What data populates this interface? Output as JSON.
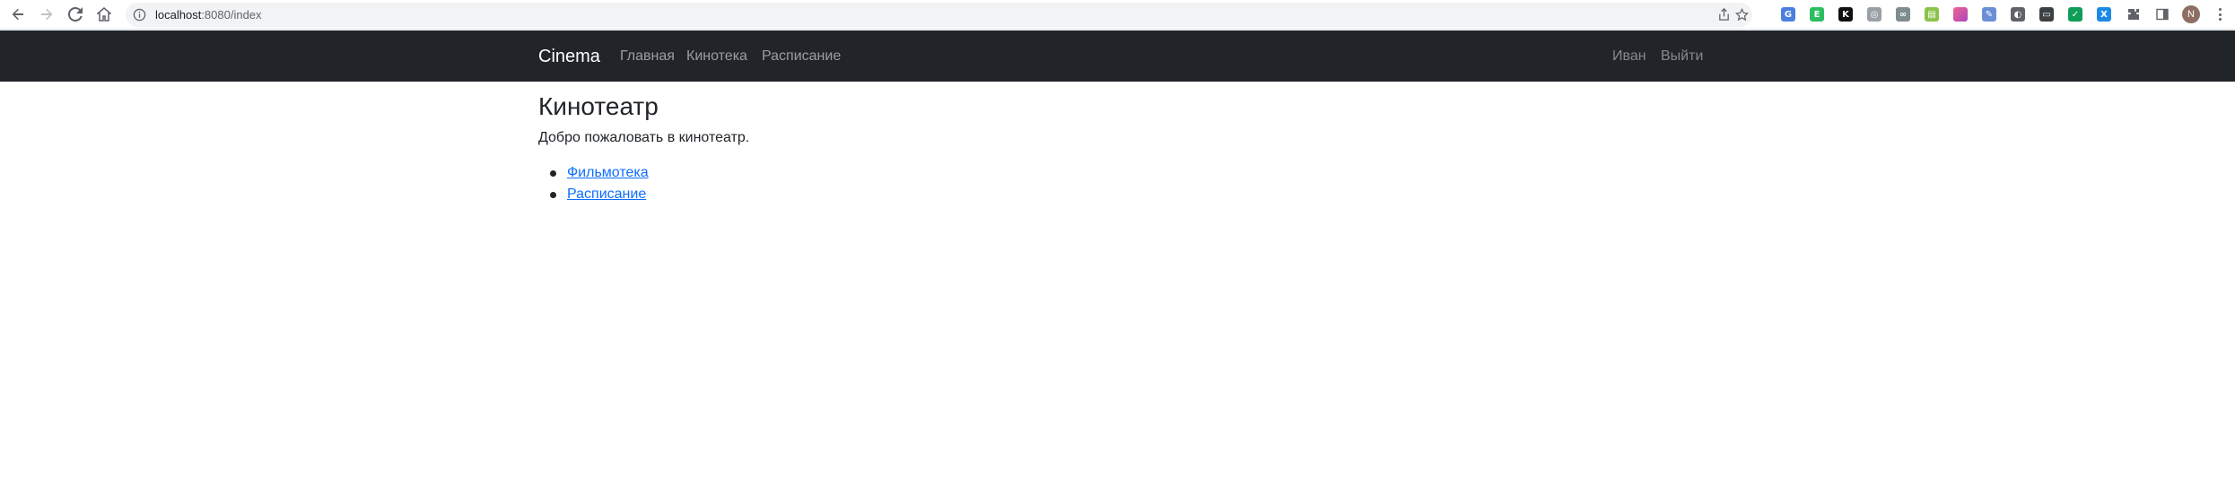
{
  "browser": {
    "url_host": "localhost",
    "url_path": ":8080/index",
    "profile_initial": "N",
    "extensions": [
      {
        "icon": "translate-extension-icon",
        "color": "#4a7fe0",
        "glyph": "G"
      },
      {
        "icon": "evernote-extension-icon",
        "color": "#2dbe60",
        "glyph": "E"
      },
      {
        "icon": "k-extension-icon",
        "color": "#111111",
        "glyph": "K"
      },
      {
        "icon": "circle-extension-icon",
        "color": "#9aa0a6",
        "glyph": "◎"
      },
      {
        "icon": "link-extension-icon",
        "color": "#7f8c8d",
        "glyph": "∞"
      },
      {
        "icon": "sheet-extension-icon",
        "color": "#8bc34a",
        "glyph": "▤"
      },
      {
        "icon": "gradient-extension-icon",
        "color": "#d63384",
        "glyph": ""
      },
      {
        "icon": "feather-extension-icon",
        "color": "#6b8fd6",
        "glyph": "✎"
      },
      {
        "icon": "speaker-extension-icon",
        "color": "#5f6368",
        "glyph": "◐"
      },
      {
        "icon": "screen-extension-icon",
        "color": "#3c4043",
        "glyph": "▭"
      },
      {
        "icon": "shield-extension-icon",
        "color": "#0f9d58",
        "glyph": "✓"
      },
      {
        "icon": "x-extension-icon",
        "color": "#1e88e5",
        "glyph": "X"
      }
    ]
  },
  "navbar": {
    "brand": "Cinema",
    "links": [
      "Главная",
      "Кинотека",
      "Расписание"
    ],
    "user": "Иван",
    "logout": "Выйти"
  },
  "main": {
    "title": "Кинотеатр",
    "welcome": "Добро пожаловать в кинотеатр.",
    "links": [
      "Фильмотека",
      "Расписание"
    ]
  }
}
